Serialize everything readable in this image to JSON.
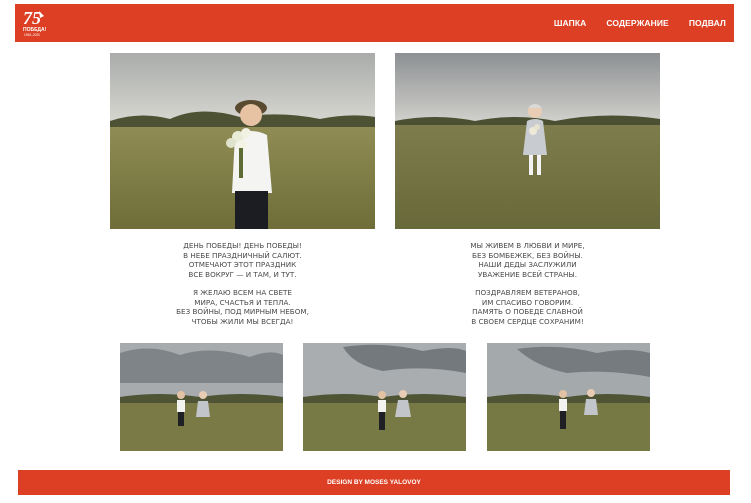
{
  "header": {
    "logo": {
      "number": "75",
      "word": "ПОБЕДА!",
      "years": "1945–2020"
    },
    "nav": [
      {
        "label": "ШАПКА"
      },
      {
        "label": "СОДЕРЖАНИЕ"
      },
      {
        "label": "ПОДВАЛ"
      }
    ]
  },
  "poems": {
    "left": {
      "stanza1": [
        "ДЕНЬ ПОБЕДЫ! ДЕНЬ ПОБЕДЫ!",
        "В НЕБЕ ПРАЗДНИЧНЫЙ САЛЮТ.",
        "ОТМЕЧАЮТ ЭТОТ ПРАЗДНИК",
        "ВСЕ ВОКРУГ — И ТАМ, И ТУТ."
      ],
      "stanza2": [
        "Я ЖЕЛАЮ ВСЕМ НА СВЕТЕ",
        "МИРА, СЧАСТЬЯ И ТЕПЛА.",
        "БЕЗ ВОЙНЫ, ПОД МИРНЫМ НЕБОМ,",
        "ЧТОБЫ ЖИЛИ МЫ ВСЕГДА!"
      ]
    },
    "right": {
      "stanza1": [
        "МЫ ЖИВЕМ В ЛЮБВИ И МИРЕ,",
        "БЕЗ БОМБЕЖЕК, БЕЗ ВОЙНЫ.",
        "НАШИ ДЕДЫ ЗАСЛУЖИЛИ",
        "УВАЖЕНИЕ ВСЕЙ СТРАНЫ."
      ],
      "stanza2": [
        "ПОЗДРАВЛЯЕМ ВЕТЕРАНОВ,",
        "ИМ СПАСИБО ГОВОРИМ.",
        "ПАМЯТЬ О ПОБЕДЕ СЛАВНОЙ",
        "В СВОЕМ СЕРДЦЕ СОХРАНИМ!"
      ]
    }
  },
  "footer": {
    "credit": "DESIGN BY MOSES YALOVOY"
  },
  "colors": {
    "brand": "#dc3f23",
    "text": "#4a4a4a",
    "background": "#ffffff"
  }
}
